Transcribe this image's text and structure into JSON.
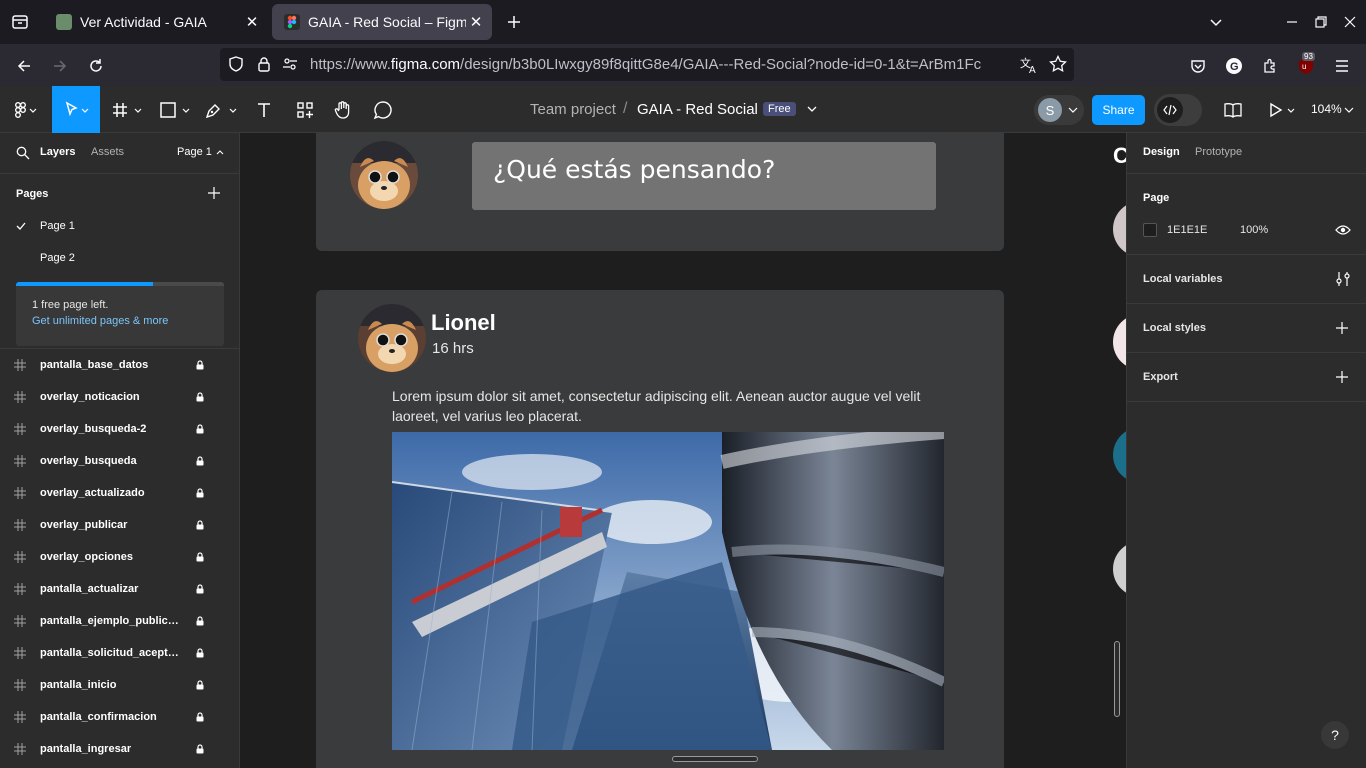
{
  "browser": {
    "tabs": [
      {
        "title": "Ver Actividad - GAIA",
        "active": false
      },
      {
        "title": "GAIA - Red Social – Figma",
        "active": true
      }
    ],
    "url_prefix": "https://www.",
    "url_domain": "figma.com",
    "url_rest": "/design/b3b0LIwxgy89f8qittG8e4/GAIA---Red-Social?node-id=0-1&t=ArBm1Fc",
    "extension_badge": "93"
  },
  "toolbar": {
    "breadcrumb_team": "Team project",
    "breadcrumb_sep": "/",
    "file_name": "GAIA - Red Social",
    "plan_badge": "Free",
    "avatar_initial": "S",
    "share_label": "Share",
    "zoom": "104%"
  },
  "left_panel": {
    "tab_layers": "Layers",
    "tab_assets": "Assets",
    "page_selector": "Page 1",
    "pages_heading": "Pages",
    "pages": [
      "Page 1",
      "Page 2"
    ],
    "selected_page": "Page 1",
    "limit_text": "1 free page left.",
    "limit_link": "Get unlimited pages & more",
    "limit_progress": 0.66,
    "layers": [
      "pantalla_base_datos",
      "overlay_noticacion",
      "overlay_busqueda-2",
      "overlay_busqueda",
      "overlay_actualizado",
      "overlay_publicar",
      "overlay_opciones",
      "pantalla_actualizar",
      "pantalla_ejemplo_publicacion",
      "pantalla_solicitud_aceptada",
      "pantalla_inicio",
      "pantalla_confirmacion",
      "pantalla_ingresar"
    ]
  },
  "canvas": {
    "composer_placeholder": "¿Qué estás pensando?",
    "post_author": "Lionel",
    "post_time": "16 hrs",
    "post_text": "Lorem ipsum dolor sit amet, consectetur adipiscing elit. Aenean auctor  augue vel velit laoreet, vel varius leo placerat.",
    "right_frame_letter": "C"
  },
  "right_panel": {
    "tab_design": "Design",
    "tab_prototype": "Prototype",
    "page_heading": "Page",
    "page_color": "1E1E1E",
    "page_color_hex": "#1e1e1e",
    "page_opacity": "100%",
    "local_variables": "Local variables",
    "local_styles": "Local styles",
    "export": "Export",
    "help": "?"
  },
  "colors": {
    "accent_blue": "#0d99ff",
    "link_blue": "#7cc4f8",
    "card_bg": "#3a3b3c",
    "composer_input": "#737373"
  }
}
